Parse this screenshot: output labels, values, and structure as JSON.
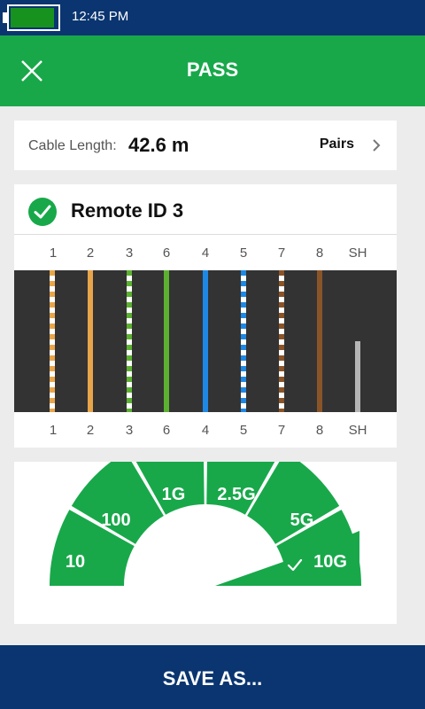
{
  "status_bar": {
    "time": "12:45 PM",
    "battery_level": 0.95,
    "battery_color": "#17921f"
  },
  "header": {
    "title": "PASS",
    "close_icon": "close-icon",
    "color": "#18a84a"
  },
  "cable": {
    "length_label": "Cable Length:",
    "length_value": "42.6 m",
    "pairs_label": "Pairs",
    "chevron_icon": "chevron-right-icon"
  },
  "wiremap": {
    "remote_label": "Remote ID 3",
    "status_icon": "check-circle-icon",
    "pins": [
      "1",
      "2",
      "3",
      "6",
      "4",
      "5",
      "7",
      "8",
      "SH"
    ],
    "wires": [
      {
        "pin": "1",
        "color": "#e8a54a",
        "striped": true
      },
      {
        "pin": "2",
        "color": "#e8a54a",
        "striped": false
      },
      {
        "pin": "3",
        "color": "#5cb131",
        "striped": true
      },
      {
        "pin": "6",
        "color": "#5cb131",
        "striped": false
      },
      {
        "pin": "4",
        "color": "#1e88e5",
        "striped": false
      },
      {
        "pin": "5",
        "color": "#1e88e5",
        "striped": true
      },
      {
        "pin": "7",
        "color": "#8a5428",
        "striped": true
      },
      {
        "pin": "8",
        "color": "#8a5428",
        "striped": false
      },
      {
        "pin": "SH",
        "color": "#b5b5b5",
        "striped": false
      }
    ]
  },
  "speed": {
    "segments": [
      "10",
      "100",
      "1G",
      "2.5G",
      "5G",
      "10G"
    ],
    "result": "10G",
    "result_icon": "checkmark-icon",
    "color": "#18a84a"
  },
  "footer": {
    "save_label": "SAVE AS..."
  }
}
